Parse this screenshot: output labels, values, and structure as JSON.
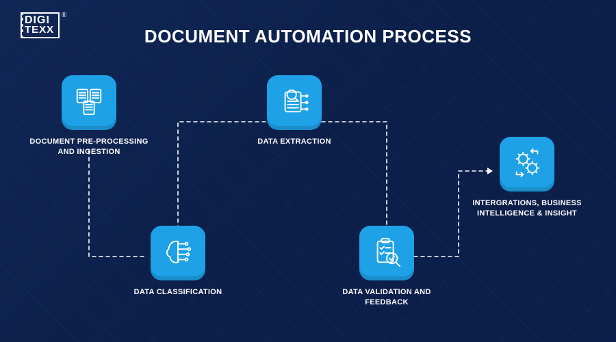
{
  "brand": {
    "top": "DIGI",
    "bottom": "TEXX",
    "registered": "®"
  },
  "title": "DOCUMENT AUTOMATION PROCESS",
  "nodes": {
    "preprocessing": {
      "label": "DOCUMENT PRE-PROCESSING AND INGESTION"
    },
    "classification": {
      "label": "DATA CLASSIFICATION"
    },
    "extraction": {
      "label": "DATA EXTRACTION"
    },
    "validation": {
      "label": "DATA VALIDATION AND FEEDBACK"
    },
    "integrations": {
      "label": "INTERGRATIONS, BUSINESS INTELLIGENCE & INSIGHT"
    }
  },
  "colors": {
    "bg": "#0c1f4a",
    "accent": "#1ea1e6",
    "text": "#ffffff"
  }
}
